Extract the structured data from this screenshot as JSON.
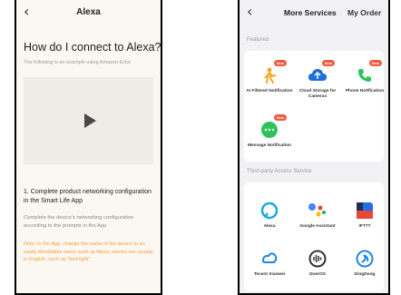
{
  "left_screen": {
    "back_glyph": "‹",
    "title": "Alexa",
    "heading": "How do I connect to Alexa?",
    "subheading": "The following is an example using Amazon Echo",
    "step_title": "1. Complete product networking configuration in the Smart Life App",
    "step_desc": "Complete the device's networking configuration according to the prompts in the App",
    "note": "Note: In the App, change the name of the device to an easily identifiable name such as Alexa; names are usually in English, such as \"bed light\""
  },
  "right_screen": {
    "back_glyph": "‹",
    "tabs": [
      "More Services",
      "My Order"
    ],
    "featured_label": "Featured",
    "featured": [
      {
        "label": "AI Filtered Notification",
        "icon": "person-filter-icon",
        "badge": "New",
        "color": "#f5a623"
      },
      {
        "label": "Cloud Storage for Cameras",
        "icon": "cloud-icon",
        "badge": "New",
        "color": "#1e6fd9"
      },
      {
        "label": "Phone Notification",
        "icon": "phone-icon",
        "badge": "New",
        "color": "#2fc25b"
      },
      {
        "label": "Message Notification",
        "icon": "message-icon",
        "badge": "New",
        "color": "#2fc25b"
      }
    ],
    "third_party_label": "Third-party Access Service",
    "third_party": [
      {
        "label": "Alexa",
        "icon": "alexa-icon",
        "color": "#1ea7e1"
      },
      {
        "label": "Google Assistant",
        "icon": "google-assistant-icon",
        "color": "#4285f4"
      },
      {
        "label": "IFTTT",
        "icon": "ifttt-icon",
        "color": "#1f2f5a"
      },
      {
        "label": "Tecent Xiaowei",
        "icon": "xiaowei-icon",
        "color": "#1e88e5"
      },
      {
        "label": "DuerOS",
        "icon": "dueros-icon",
        "color": "#333333"
      },
      {
        "label": "DingDong",
        "icon": "dingdong-icon",
        "color": "#1e88e5"
      }
    ]
  }
}
